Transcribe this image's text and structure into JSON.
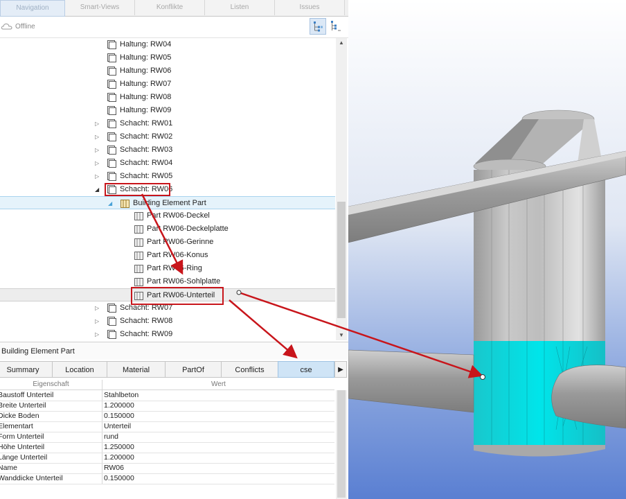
{
  "nav_tabs": [
    "Navigation",
    "Smart-Views",
    "Konflikte",
    "Listen",
    "Issues"
  ],
  "status": "Offline",
  "tree": [
    {
      "label": "Haltung: RW04"
    },
    {
      "label": "Haltung: RW05"
    },
    {
      "label": "Haltung: RW06"
    },
    {
      "label": "Haltung: RW07"
    },
    {
      "label": "Haltung: RW08"
    },
    {
      "label": "Haltung: RW09"
    },
    {
      "label": "Schacht: RW01"
    },
    {
      "label": "Schacht: RW02"
    },
    {
      "label": "Schacht: RW03"
    },
    {
      "label": "Schacht: RW04"
    },
    {
      "label": "Schacht: RW05"
    },
    {
      "label": "Schacht: RW06"
    },
    {
      "label": "Building Element Part"
    },
    {
      "label": "Part RW06-Deckel"
    },
    {
      "label": "Part RW06-Deckelplatte"
    },
    {
      "label": "Part RW06-Gerinne"
    },
    {
      "label": "Part RW06-Konus"
    },
    {
      "label": "Part RW06-Ring"
    },
    {
      "label": "Part RW06-Sohlplatte"
    },
    {
      "label": "Part RW06-Unterteil"
    },
    {
      "label": "Schacht: RW07"
    },
    {
      "label": "Schacht: RW08"
    },
    {
      "label": "Schacht: RW09"
    }
  ],
  "properties": {
    "title": "Building Element Part",
    "tabs": [
      "Summary",
      "Location",
      "Material",
      "PartOf",
      "Conflicts",
      "cse"
    ],
    "columns": {
      "key": "Eigenschaft",
      "value": "Wert"
    },
    "rows": [
      {
        "key": "Baustoff Unterteil",
        "value": "Stahlbeton"
      },
      {
        "key": "Breite Unterteil",
        "value": "1.200000"
      },
      {
        "key": "Dicke Boden",
        "value": "0.150000"
      },
      {
        "key": "Elementart",
        "value": "Unterteil"
      },
      {
        "key": "Form Unterteil",
        "value": "rund"
      },
      {
        "key": "Höhe Unterteil",
        "value": "1.250000"
      },
      {
        "key": "Länge Unterteil",
        "value": "1.200000"
      },
      {
        "key": "Name",
        "value": "RW06"
      },
      {
        "key": "Wanddicke Unterteil",
        "value": "0.150000"
      }
    ]
  },
  "colors": {
    "highlight": "#00e0e0",
    "annotation": "#c8151b",
    "selection": "#e5f3fb"
  }
}
